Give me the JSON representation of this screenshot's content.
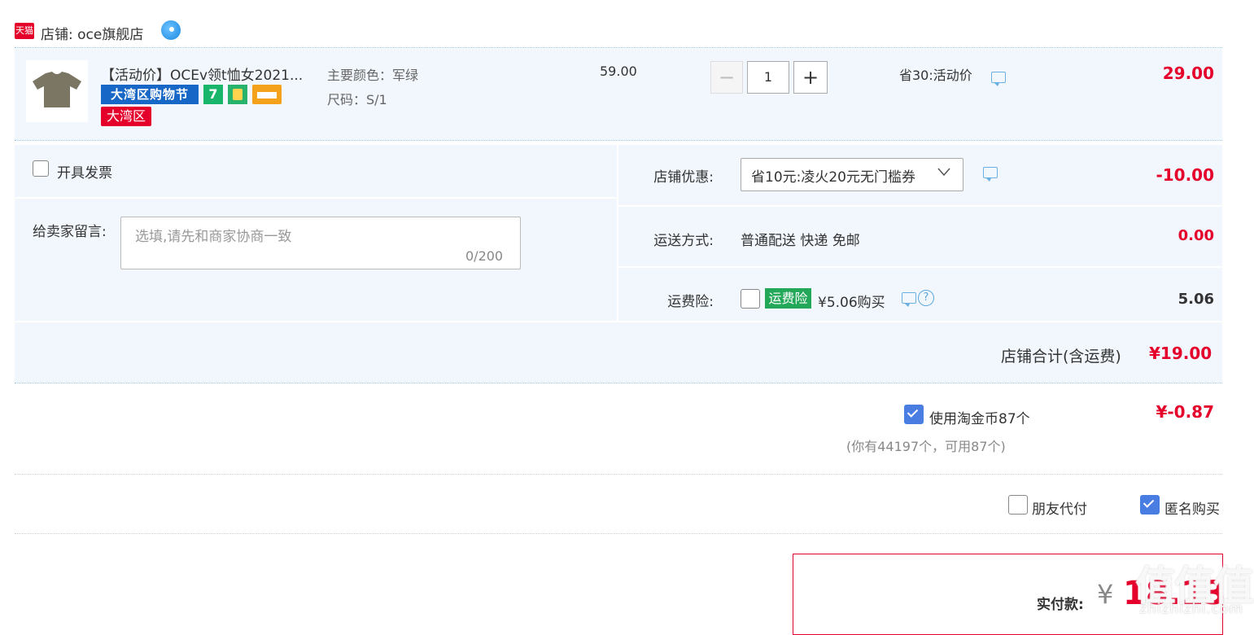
{
  "shop": {
    "tmall_badge": "天猫",
    "label": "店铺: oce旗舰店"
  },
  "item": {
    "title": "【活动价】OCEv领t恤女2021...",
    "tags": {
      "bay_festival": "大湾区购物节",
      "seven": "7",
      "bay_area": "大湾区"
    },
    "sku_color": "主要颜色：军绿",
    "sku_size": "尺码：S/1",
    "unit_price": "59.00",
    "quantity": "1",
    "minus": "−",
    "plus": "+",
    "promo": "省30:活动价",
    "total": "29.00"
  },
  "invoice": {
    "label": "开具发票",
    "checked": false
  },
  "message": {
    "label": "给卖家留言:",
    "placeholder": "选填,请先和商家协商一致",
    "count": "0/200"
  },
  "shop_discount": {
    "label": "店铺优惠:",
    "selected": "省10元:凌火20元无门槛券",
    "value": "-10.00"
  },
  "shipping": {
    "label": "运送方式:",
    "method": "普通配送 快递 免邮",
    "value": "0.00"
  },
  "insurance": {
    "label": "运费险:",
    "tag": "运费险",
    "price_text": "¥5.06购买",
    "help": "?",
    "value": "5.06"
  },
  "subtotal": {
    "label": "店铺合计(含运费)",
    "value": "¥19.00"
  },
  "coins": {
    "label": "使用淘金币87个",
    "value": "¥-0.87",
    "note": "(你有44197个，可用87个)"
  },
  "options": {
    "friend_pay": "朋友代付",
    "anonymous": "匿名购买"
  },
  "payment": {
    "label": "实付款:",
    "currency": "¥",
    "amount": "18.13"
  },
  "watermark": {
    "text": "值值值",
    "sub": "zhizhizhi.com"
  },
  "colors": {
    "accent_red": "#e4002b",
    "row_bg": "#f2f7fd",
    "check_blue": "#4a7de2",
    "insurance_green": "#23a85a"
  }
}
